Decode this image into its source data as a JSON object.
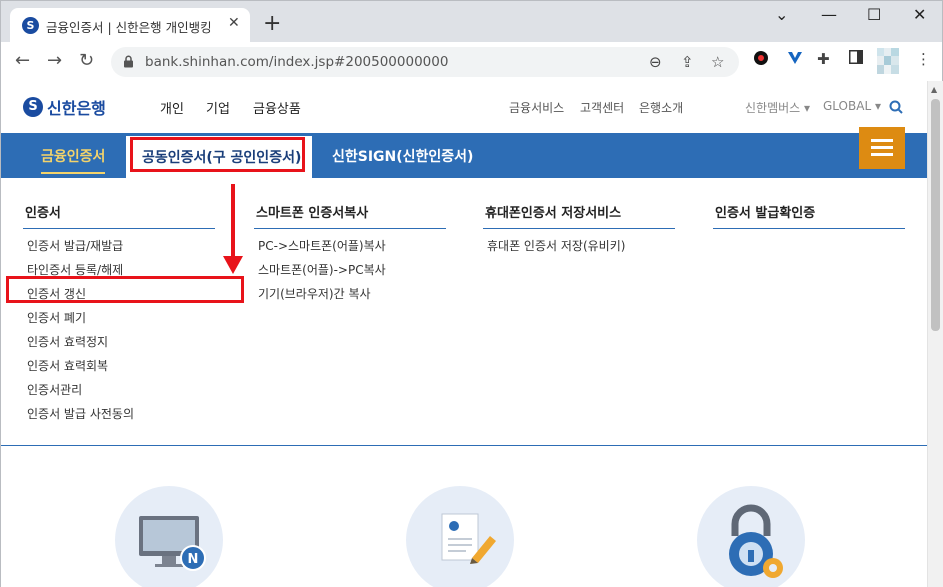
{
  "browser": {
    "tab_title": "금융인증서 | 신한은행 개인뱅킹",
    "tab_close": "✕",
    "new_tab": "+",
    "url": "bank.shinhan.com/index.jsp#200500000000",
    "window_controls": [
      "⌄",
      "—",
      "☐",
      "✕"
    ]
  },
  "header": {
    "logo_mark": "S",
    "logo_text": "신한은행",
    "gnb": [
      "개인",
      "기업",
      "금융상품"
    ],
    "util": [
      "금융서비스",
      "고객센터",
      "은행소개"
    ],
    "member": "신한멤버스 ▾",
    "global": "GLOBAL ▾"
  },
  "menu_tabs": {
    "tab1": "금융인증서",
    "tab2": "공동인증서(구 공인인증서)",
    "tab3": "신한SIGN(신한인증서)"
  },
  "dropdown": {
    "columns": [
      {
        "title": "인증서",
        "items": [
          "인증서 발급/재발급",
          "타인증서 등록/해제",
          "인증서 갱신",
          "인증서 폐기",
          "인증서 효력정지",
          "인증서 효력회복",
          "인증서관리",
          "인증서 발급 사전동의"
        ]
      },
      {
        "title": "스마트폰 인증서복사",
        "items": [
          "PC->스마트폰(어플)복사",
          "스마트폰(어플)->PC복사",
          "기기(브라우저)간 복사"
        ]
      },
      {
        "title": "휴대폰인증서 저장서비스",
        "items": [
          "휴대폰 인증서 저장(유비키)"
        ]
      },
      {
        "title": "인증서 발급확인증",
        "items": []
      }
    ]
  },
  "colors": {
    "brand_blue": "#2d6db5",
    "logo_blue": "#1a4ba0",
    "active_gold": "#f3d36b",
    "hamburger_orange": "#dd8b12",
    "annotation_red": "#e8131a"
  },
  "icons": [
    "computer-certificate-icon",
    "document-pen-icon",
    "lock-gear-icon"
  ]
}
